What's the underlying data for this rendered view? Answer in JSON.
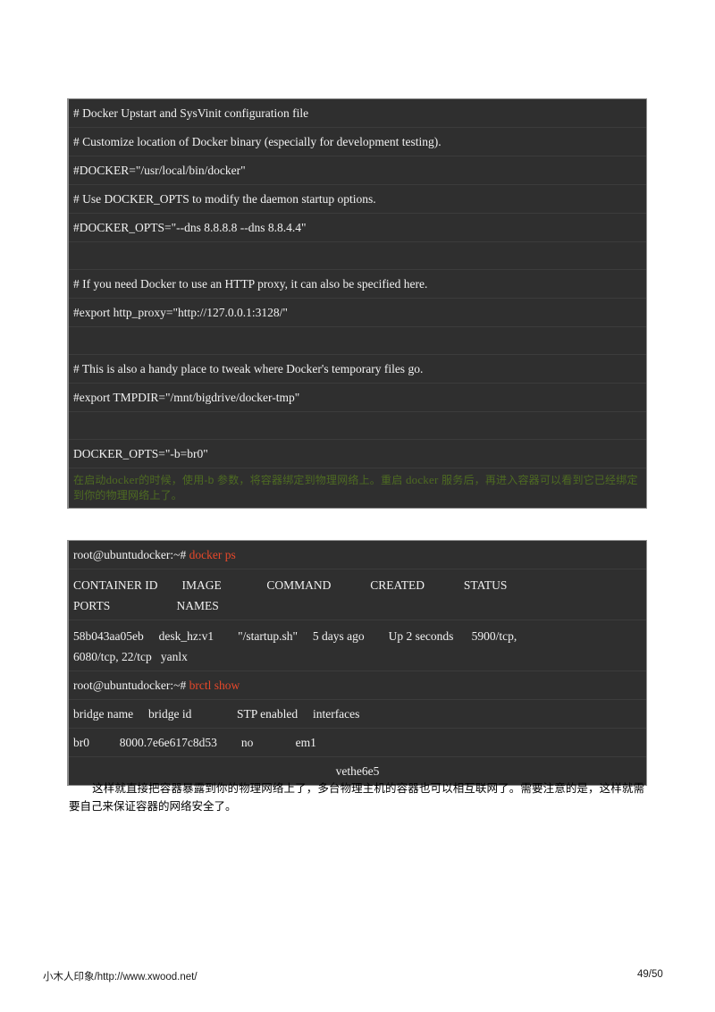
{
  "document": {
    "page_background": "#ffffff",
    "code_background": "#2f2f2f",
    "code_text_color": "#f2f2f2",
    "command_color": "#e8482a",
    "annotation_color": "#4e6b22"
  },
  "config_block": {
    "name": "docker-upstart-config",
    "lines": [
      {
        "text": "# Docker Upstart and SysVinit configuration file"
      },
      {
        "text": "# Customize location of Docker binary (especially for development testing)."
      },
      {
        "text": "#DOCKER=\"/usr/local/bin/docker\""
      },
      {
        "text": "# Use DOCKER_OPTS to modify the daemon startup options."
      },
      {
        "text": "#DOCKER_OPTS=\"--dns 8.8.8.8 --dns 8.8.4.4\""
      },
      {
        "text": ""
      },
      {
        "text": "# If you need Docker to use an HTTP proxy, it can also be specified here."
      },
      {
        "text": "#export http_proxy=\"http://127.0.0.1:3128/\""
      },
      {
        "text": ""
      },
      {
        "text": "# This is also a handy place to tweak where Docker's temporary files go."
      },
      {
        "text": "#export TMPDIR=\"/mnt/bigdrive/docker-tmp\""
      },
      {
        "text": ""
      },
      {
        "text": "DOCKER_OPTS=\"-b=br0\""
      }
    ],
    "annotation": {
      "part1": "在启动",
      "latin1": "docker",
      "part2": "的时候，使用-b 参数，将容器绑定到物理网络上。重启 ",
      "latin2": "docker",
      "part3": " 服务后，再进入容器可以看到它已经绑定到你的物理网络上了。"
    }
  },
  "terminal_block": {
    "name": "docker-terminal-session",
    "prompt": "root@ubuntudocker:~#",
    "commands": {
      "docker_ps": "docker ps",
      "brctl_show": "brctl show"
    },
    "docker_ps_table": {
      "header_line_1": "CONTAINER ID        IMAGE               COMMAND             CREATED             STATUS",
      "header_line_2": "PORTS                      NAMES",
      "row_line_1": "58b043aa05eb     desk_hz:v1        \"/startup.sh\"     5 days ago        Up 2 seconds      5900/tcp,",
      "row_line_2": "6080/tcp, 22/tcp   yanlx",
      "columns": [
        "CONTAINER ID",
        "IMAGE",
        "COMMAND",
        "CREATED",
        "STATUS",
        "PORTS",
        "NAMES"
      ],
      "values": {
        "container_id": "58b043aa05eb",
        "image": "desk_hz:v1",
        "command": "\"/startup.sh\"",
        "created": "5 days ago",
        "status": "Up 2 seconds",
        "ports": "5900/tcp, 6080/tcp, 22/tcp",
        "names": "yanlx"
      }
    },
    "brctl_table": {
      "header": "bridge name     bridge id               STP enabled     interfaces",
      "row_1": "br0          8000.7e6e617c8d53        no              em1",
      "row_2": "vethe6e5",
      "columns": [
        "bridge name",
        "bridge id",
        "STP enabled",
        "interfaces"
      ],
      "values": {
        "bridge_name": "br0",
        "bridge_id": "8000.7e6e617c8d53",
        "stp_enabled": "no",
        "interfaces": [
          "em1",
          "vethe6e5"
        ]
      }
    }
  },
  "paragraph": {
    "text": "这样就直接把容器暴露到你的物理网络上了，多台物理主机的容器也可以相互联网了。需要注意的是，这样就需要自己来保证容器的网络安全了。"
  },
  "footer": {
    "left": "小木人印象/http://www.xwood.net/",
    "page_number": "49/50"
  }
}
